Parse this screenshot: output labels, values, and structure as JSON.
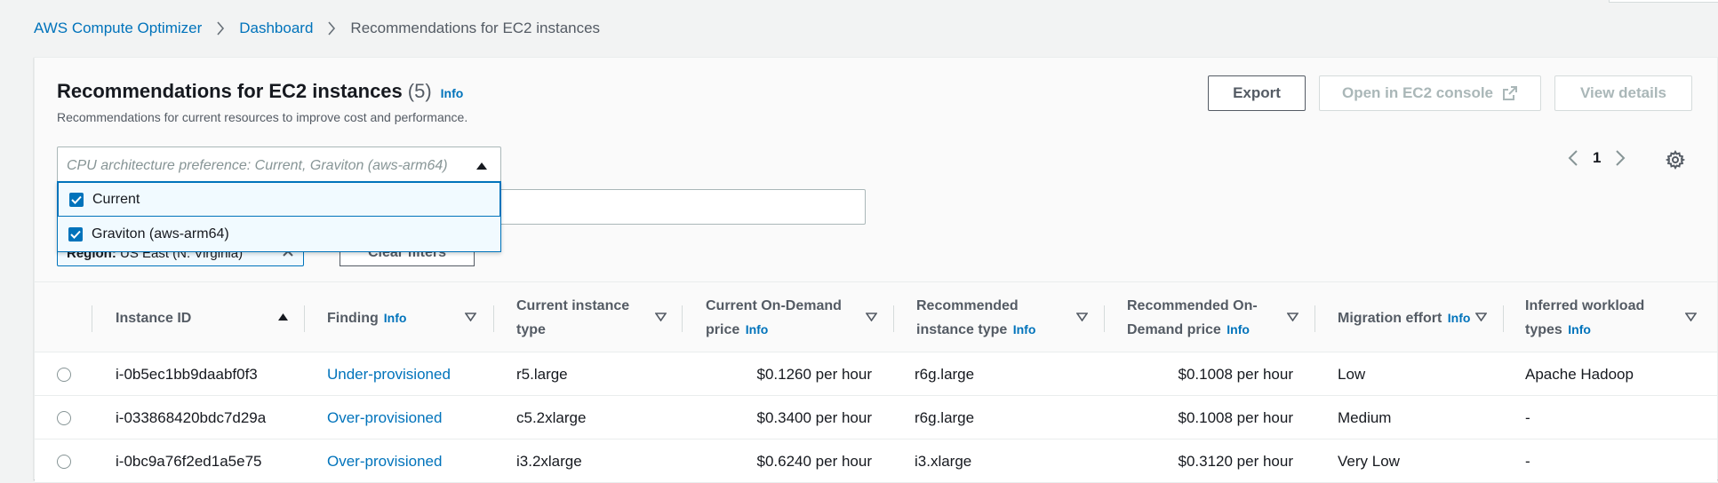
{
  "breadcrumb": {
    "items": [
      "AWS Compute Optimizer",
      "Dashboard"
    ],
    "current": "Recommendations for EC2 instances"
  },
  "panel": {
    "title": "Recommendations for EC2 instances",
    "count": "(5)",
    "info": "Info",
    "subtitle": "Recommendations for current resources to improve cost and performance."
  },
  "actions": {
    "export": "Export",
    "open_ec2": "Open in EC2 console",
    "view_details": "View details"
  },
  "pagination": {
    "page": "1"
  },
  "filter": {
    "placeholder": "CPU architecture preference: Current, Graviton (aws-arm64)",
    "options": [
      "Current",
      "Graviton (aws-arm64)"
    ],
    "region_label": "Region:",
    "region_value": "US East (N. Virginia)",
    "clear_filters": "Clear filters"
  },
  "table": {
    "columns": [
      {
        "label": "Instance ID",
        "info": ""
      },
      {
        "label": "Finding",
        "info": "Info"
      },
      {
        "label": "Current instance type",
        "info": ""
      },
      {
        "label": "Current On-Demand price",
        "info": "Info"
      },
      {
        "label": "Recommended instance type",
        "info": "Info"
      },
      {
        "label": "Recommended On-Demand price",
        "info": "Info"
      },
      {
        "label": "Migration effort",
        "info": "Info"
      },
      {
        "label": "Inferred workload types",
        "info": "Info"
      }
    ],
    "rows": [
      {
        "id": "i-0b5ec1bb9daabf0f3",
        "finding": "Under-provisioned",
        "current_type": "r5.large",
        "current_price": "$0.1260 per hour",
        "rec_type": "r6g.large",
        "rec_price": "$0.1008 per hour",
        "effort": "Low",
        "workload": "Apache Hadoop"
      },
      {
        "id": "i-033868420bdc7d29a",
        "finding": "Over-provisioned",
        "current_type": "c5.2xlarge",
        "current_price": "$0.3400 per hour",
        "rec_type": "r6g.large",
        "rec_price": "$0.1008 per hour",
        "effort": "Medium",
        "workload": "-"
      },
      {
        "id": "i-0bc9a76f2ed1a5e75",
        "finding": "Over-provisioned",
        "current_type": "i3.2xlarge",
        "current_price": "$0.6240 per hour",
        "rec_type": "i3.xlarge",
        "rec_price": "$0.3120 per hour",
        "effort": "Very Low",
        "workload": "-"
      }
    ]
  },
  "colors": {
    "link": "#0073bb",
    "text": "#16191f",
    "muted": "#545b64",
    "background": "#f2f3f3"
  },
  "icons": {
    "breadcrumb_separator": "chevron-right-icon",
    "external": "external-link-icon",
    "settings": "gear-icon",
    "prev": "chevron-left-icon",
    "next": "chevron-right-icon",
    "sort_asc": "caret-up-icon",
    "sort": "caret-down-outline-icon",
    "checkbox": "checkmark-icon"
  }
}
